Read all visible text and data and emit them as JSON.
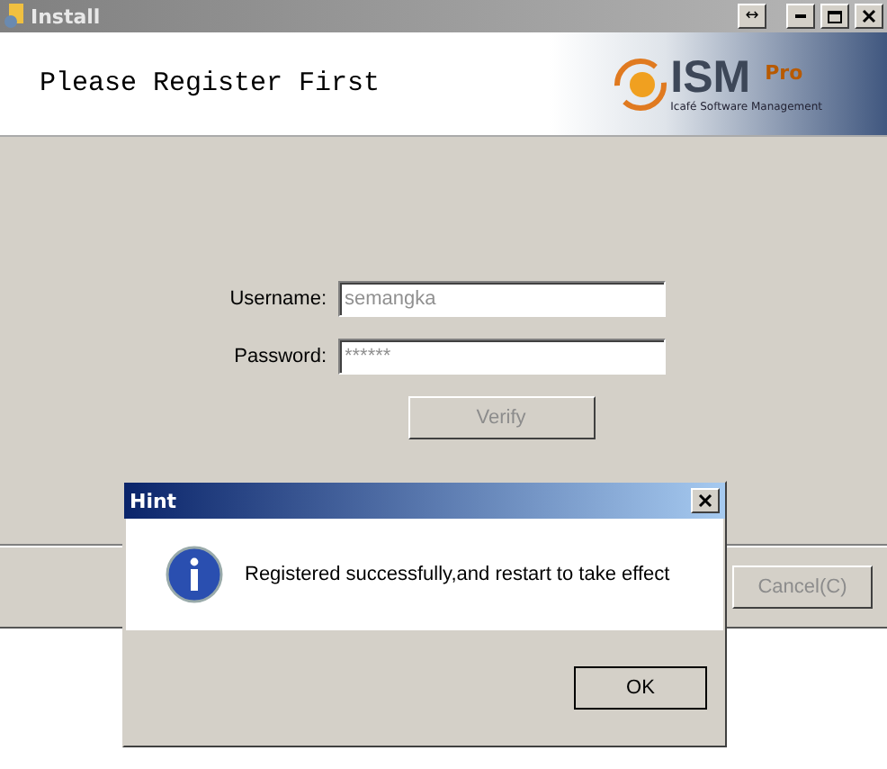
{
  "window": {
    "title": "Install",
    "controls": [
      "↔"
    ]
  },
  "header": {
    "heading": "Please Register First",
    "logo": {
      "name": "ISM",
      "badge": "Pro",
      "tagline": "Icafé Software Management"
    }
  },
  "form": {
    "fields": [
      {
        "label": "Username:",
        "value": "semangka",
        "disabled": true
      },
      {
        "label": "Password:",
        "value": "******",
        "disabled": true
      }
    ],
    "verify": {
      "label": "Verify",
      "disabled": true
    }
  },
  "footer": {
    "cancel": {
      "label": "Cancel(C)",
      "disabled": true
    }
  },
  "dialog": {
    "title": "Hint",
    "message": "Registered successfully,and restart to take effect",
    "button": "OK"
  }
}
